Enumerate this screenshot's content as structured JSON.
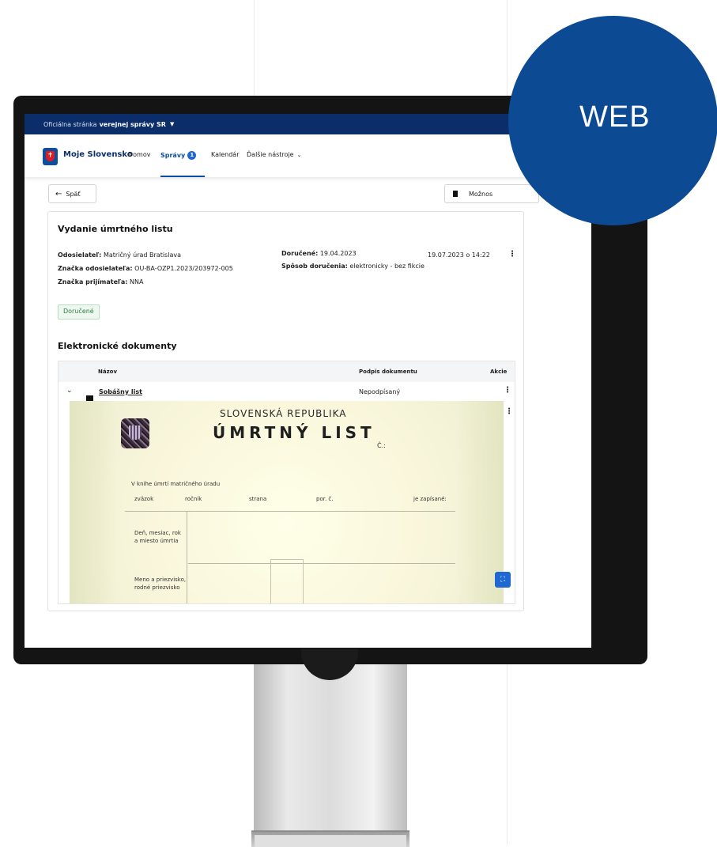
{
  "badge": {
    "label": "WEB"
  },
  "govbar": {
    "prefix": "Oficiálna stránka",
    "strong": "verejnej správy SR"
  },
  "nav": {
    "brand": "Moje Slovensko",
    "items": [
      {
        "label": "Domov"
      },
      {
        "label": "Správy",
        "badge": "1"
      },
      {
        "label": "Kalendár"
      },
      {
        "label": "Ďalšie nástroje"
      }
    ]
  },
  "toolbar": {
    "back_label": "Späť",
    "options_label": "Možnos"
  },
  "message": {
    "title": "Vydanie úmrtného listu",
    "sender_label": "Odosielateľ:",
    "sender_value": "Matričný úrad Bratislava",
    "sender_ref_label": "Značka odosielateľa:",
    "sender_ref_value": "OU-BA-OZP1.2023/203972-005",
    "recipient_ref_label": "Značka prijímateľa:",
    "recipient_ref_value": "NNA",
    "delivered_label": "Doručené:",
    "delivered_value": "19.04.2023",
    "delivery_method_label": "Spôsob doručenia:",
    "delivery_method_value": "elektronicky - bez fikcie",
    "timestamp": "19.07.2023 o 14:22",
    "status": "Doručené"
  },
  "documents": {
    "title": "Elektronické dokumenty",
    "columns": [
      "Názov",
      "Podpis dokumentu",
      "Akcie"
    ],
    "rows": [
      {
        "name": "Sobášny list",
        "signature": "Nepodpísaný"
      }
    ]
  },
  "certificate": {
    "country": "SLOVENSKÁ REPUBLIKA",
    "title": "ÚMRTNÝ LIST",
    "number_label": "Č.:",
    "register_label": "V knihe úmrtí matričného úradu",
    "fields": [
      "zväzok",
      "ročník",
      "strana",
      "por. č.",
      "je zapísané:"
    ],
    "row1": "Deň, mesiac, rok\na miesto úmrtia",
    "row2": "Meno a priezvisko,\nrodné priezvisko"
  },
  "icons": {
    "back": "arrow-left-icon",
    "trash": "trash-icon",
    "kebab": "more-vertical-icon",
    "expand": "chevron-down-icon",
    "envelope": "envelope-icon",
    "fullscreen": "fullscreen-icon"
  },
  "colors": {
    "gov_blue": "#0b2e6b",
    "accent_blue": "#1f68d1",
    "badge_blue": "#0c4a93",
    "status_green": "#2e7d43"
  }
}
